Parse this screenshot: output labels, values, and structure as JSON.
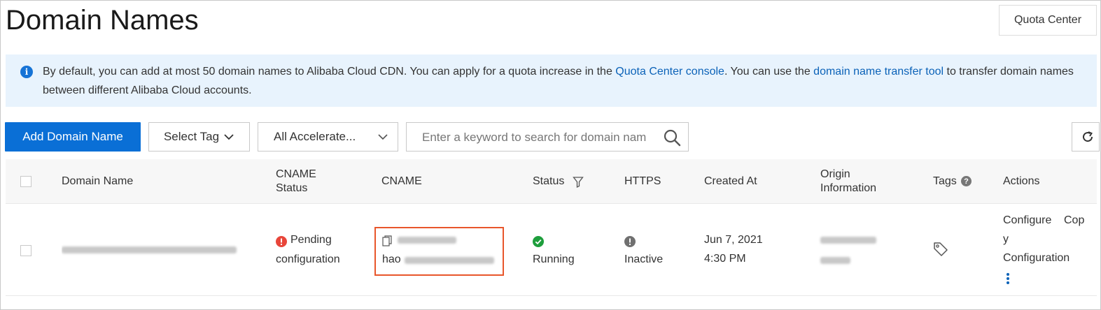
{
  "header": {
    "title": "Domain Names",
    "quota_button": "Quota Center"
  },
  "notice": {
    "icon": "info-icon",
    "text_part1": "By default, you can add at most 50 domain names to Alibaba Cloud CDN. You can apply for a quota increase in the ",
    "link1": "Quota Center console",
    "text_part2": ". You can use the ",
    "link2": "domain name transfer tool",
    "text_part3": " to transfer domain names between different Alibaba Cloud accounts."
  },
  "toolbar": {
    "add_button": "Add Domain Name",
    "tag_select": "Select Tag",
    "accel_select": "All Accelerate...",
    "search_placeholder": "Enter a keyword to search for domain nam"
  },
  "table": {
    "columns": {
      "domain_name": "Domain Name",
      "cname_status_1": "CNAME",
      "cname_status_2": "Status",
      "cname": "CNAME",
      "status": "Status",
      "https": "HTTPS",
      "created_at": "Created At",
      "origin_1": "Origin",
      "origin_2": "Information",
      "tags": "Tags",
      "actions": "Actions"
    },
    "rows": [
      {
        "cname_status_1": "Pending",
        "cname_status_2": "configuration",
        "cname_line2_prefix": "hao",
        "status": "Running",
        "https": "Inactive",
        "created_date": "Jun 7, 2021",
        "created_time": "4:30 PM",
        "action_configure": "Configure",
        "action_copy_1": "Cop",
        "action_copy_2": "y",
        "action_copy_3": "Configuration"
      }
    ]
  },
  "colors": {
    "primary": "#0a6fd6",
    "link": "#0b62b8",
    "notice_bg": "#e8f3fd",
    "running": "#1e9e3c",
    "pending": "#e8463a",
    "inactive": "#707070",
    "highlight": "#e8562b"
  }
}
